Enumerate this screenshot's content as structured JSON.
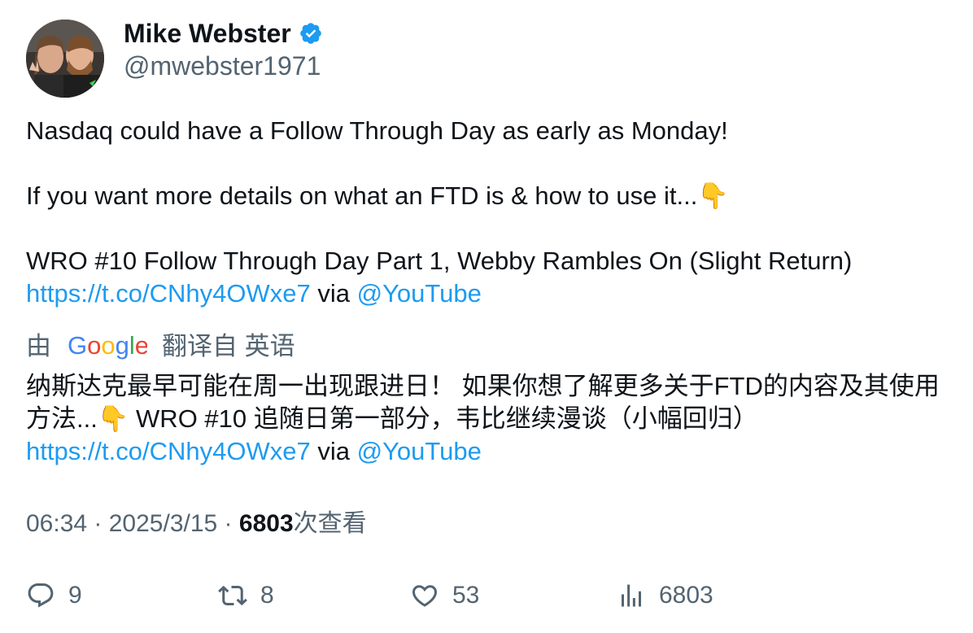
{
  "author": {
    "name": "Mike Webster",
    "handle": "@mwebster1971",
    "verified_color": "#1d9bf0"
  },
  "tweet": {
    "line1": "Nasdaq could have a Follow Through Day as early as Monday!",
    "line2": "If you want more details on what an FTD is & how to use it...👇",
    "line3": "WRO #10 Follow Through Day Part 1, Webby Rambles On (Slight Return)",
    "link": "https://t.co/CNhy4OWxe7",
    "via": " via ",
    "mention": "@YouTube"
  },
  "translation": {
    "prefix": "由",
    "provider": "Google",
    "suffix": "翻译自 英语",
    "text": "纳斯达克最早可能在周一出现跟进日！ 如果你想了解更多关于FTD的内容及其使用方法...👇 WRO #10 追随日第一部分，韦比继续漫谈（小幅回归）",
    "link": "https://t.co/CNhy4OWxe7",
    "via": " via ",
    "mention": "@YouTube"
  },
  "meta": {
    "time": "06:34",
    "sep": " · ",
    "date": "2025/3/15",
    "sep2": " · ",
    "views": "6803",
    "views_label": "次查看"
  },
  "actions": {
    "replies": "9",
    "retweets": "8",
    "likes": "53",
    "views": "6803"
  },
  "colors": {
    "link": "#1d9bf0",
    "secondary_text": "#536471",
    "primary_text": "#0f1419"
  }
}
